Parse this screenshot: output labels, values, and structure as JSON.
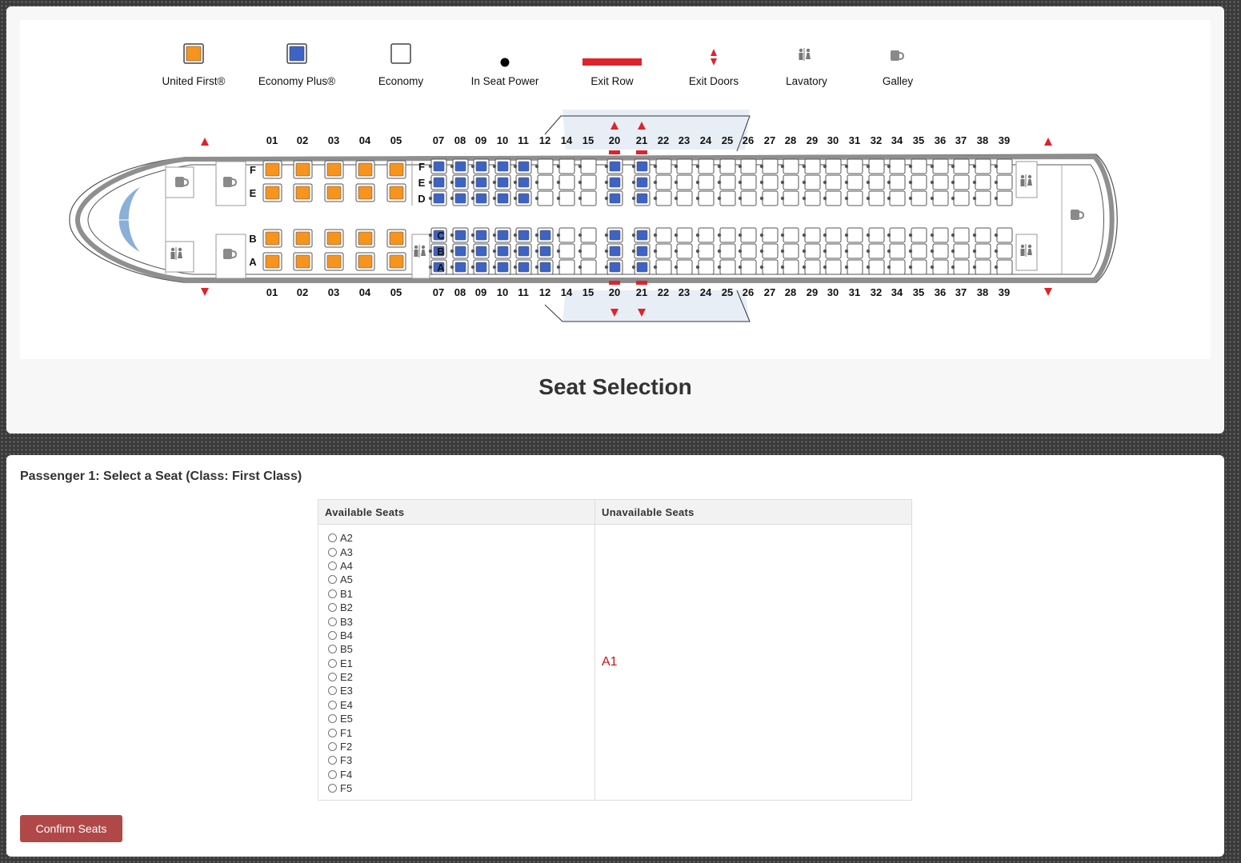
{
  "legend": [
    {
      "key": "first",
      "label": "United First®",
      "icon": "first-seat-icon"
    },
    {
      "key": "plus",
      "label": "Economy Plus®",
      "icon": "plus-seat-icon"
    },
    {
      "key": "economy",
      "label": "Economy",
      "icon": "economy-seat-icon"
    },
    {
      "key": "power",
      "label": "In Seat Power",
      "icon": "power-dot-icon"
    },
    {
      "key": "exit-row",
      "label": "Exit Row",
      "icon": "exit-row-bar-icon"
    },
    {
      "key": "exit-doors",
      "label": "Exit Doors",
      "icon": "exit-door-arrows-icon"
    },
    {
      "key": "lavatory",
      "label": "Lavatory",
      "icon": "lavatory-icon"
    },
    {
      "key": "galley",
      "label": "Galley",
      "icon": "galley-cup-icon"
    }
  ],
  "seat_map": {
    "first_rows": [
      "01",
      "02",
      "03",
      "04",
      "05"
    ],
    "first_upper_letters": [
      "F",
      "E"
    ],
    "first_lower_letters": [
      "B",
      "A"
    ],
    "economy_rows": [
      "07",
      "08",
      "09",
      "10",
      "11",
      "12",
      "14",
      "15",
      "20",
      "21",
      "22",
      "23",
      "24",
      "25",
      "26",
      "27",
      "28",
      "29",
      "30",
      "31",
      "32",
      "34",
      "35",
      "36",
      "37",
      "38",
      "39"
    ],
    "economy_upper_letters": [
      "F",
      "E",
      "D"
    ],
    "economy_lower_letters": [
      "C",
      "B",
      "A"
    ],
    "plus_rows": [
      "07",
      "08",
      "09",
      "10",
      "11",
      "20",
      "21"
    ],
    "plus_lower_only_rows": [
      "12"
    ],
    "exit_rows": [
      "20",
      "21"
    ],
    "colors": {
      "first": "#f7941d",
      "plus": "#3d63c4",
      "economy": "#ffffff",
      "exit": "#e0232b",
      "fuselage": "#8f8f8f"
    }
  },
  "page_title": "Seat Selection",
  "passenger": {
    "heading": "Passenger 1: Select a Seat (Class: First Class)",
    "table": {
      "available_header": "Available Seats",
      "unavailable_header": "Unavailable Seats",
      "available_seats": [
        "A2",
        "A3",
        "A4",
        "A5",
        "B1",
        "B2",
        "B3",
        "B4",
        "B5",
        "E1",
        "E2",
        "E3",
        "E4",
        "E5",
        "F1",
        "F2",
        "F3",
        "F4",
        "F5"
      ],
      "unavailable_seats": [
        "A1"
      ]
    },
    "confirm_label": "Confirm Seats"
  }
}
